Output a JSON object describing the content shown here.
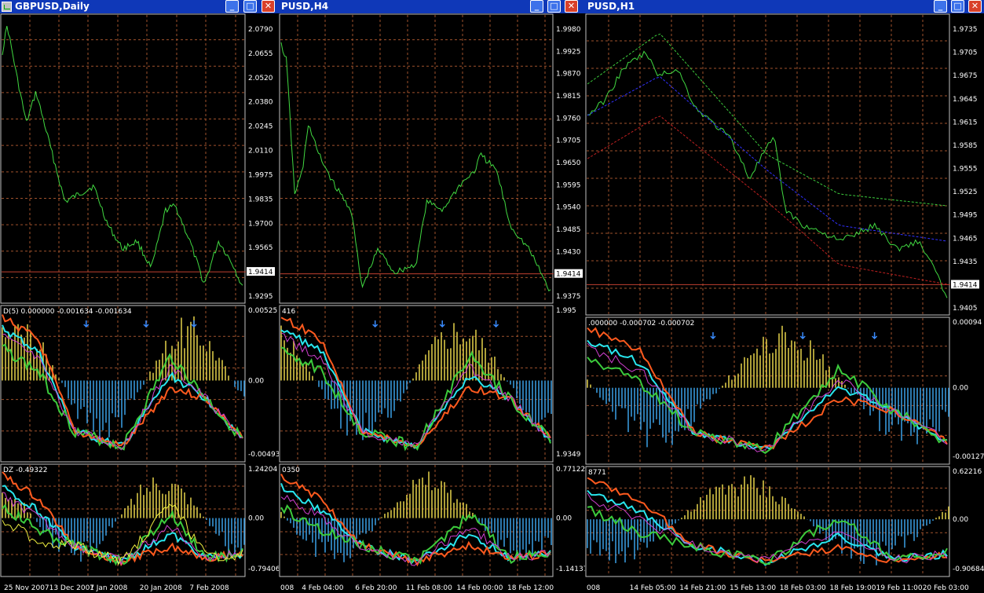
{
  "colors": {
    "titlebar": "#0f38b8",
    "price_line": "#41d941",
    "grid": "#a0522d",
    "hist_pos": "#e6d24a",
    "hist_neg": "#3aa0e6",
    "cyan": "#28e6ee",
    "orange": "#ff5a1e",
    "green": "#3ccb3c",
    "magenta": "#d040d0",
    "yellow_line": "#f0f040",
    "signal_arrow": "#3a8cff"
  },
  "windows": [
    {
      "title": "GBPUSD,Daily",
      "price_axis": [
        "2.0790",
        "2.0655",
        "2.0520",
        "2.0380",
        "2.0245",
        "2.0110",
        "1.9975",
        "1.9835",
        "1.9700",
        "1.9565",
        "1.9414",
        "1.9295"
      ],
      "current_price": "1.9414",
      "ind1_label": "D(5) 0.000000 -0.001634 -0.001634",
      "ind1_axis": [
        "0.00525",
        "0.00",
        "-0.00493"
      ],
      "ind2_label": "DZ -0.49322",
      "ind2_axis": [
        "1.24204",
        "0.00",
        "-0.79406"
      ],
      "time_axis": [
        "25 Nov 2007",
        "13 Dec 2007",
        "1 Jan 2008",
        "20 Jan 2008",
        "7 Feb 2008"
      ]
    },
    {
      "title": "PUSD,H4",
      "price_axis": [
        "1.9980",
        "1.9925",
        "1.9870",
        "1.9815",
        "1.9760",
        "1.9705",
        "1.9650",
        "1.9595",
        "1.9540",
        "1.9485",
        "1.9430",
        "1.9414",
        "1.9375"
      ],
      "current_price": "1.9414",
      "ind1_label": "416",
      "ind1_axis": [
        "1.995",
        "1.9349"
      ],
      "ind2_label": "0350",
      "ind2_axis": [
        "0.77122",
        "0.00",
        "-1.14137"
      ],
      "time_axis": [
        "008",
        "4 Feb 04:00",
        "6 Feb 20:00",
        "11 Feb 08:00",
        "14 Feb 00:00",
        "18 Feb 12:00"
      ]
    },
    {
      "title": "PUSD,H1",
      "price_axis": [
        "1.9735",
        "1.9705",
        "1.9675",
        "1.9645",
        "1.9615",
        "1.9585",
        "1.9555",
        "1.9525",
        "1.9495",
        "1.9465",
        "1.9435",
        "1.9414",
        "1.9405"
      ],
      "current_price": "1.9414",
      "ind1_label": ".000000 -0.000702 -0.000702",
      "ind1_axis": [
        "0.00094",
        "0.00",
        "-0.00127"
      ],
      "ind2_label": "8771",
      "ind2_axis": [
        "0.62216",
        "0.00",
        "-0.90684"
      ],
      "time_axis": [
        "008",
        "14 Feb 05:00",
        "14 Feb 21:00",
        "15 Feb 13:00",
        "18 Feb 03:00",
        "18 Feb 19:00",
        "19 Feb 11:00",
        "20 Feb 03:00"
      ]
    }
  ],
  "window_buttons": {
    "minimize": "_",
    "maximize": "□",
    "close": "✕"
  }
}
